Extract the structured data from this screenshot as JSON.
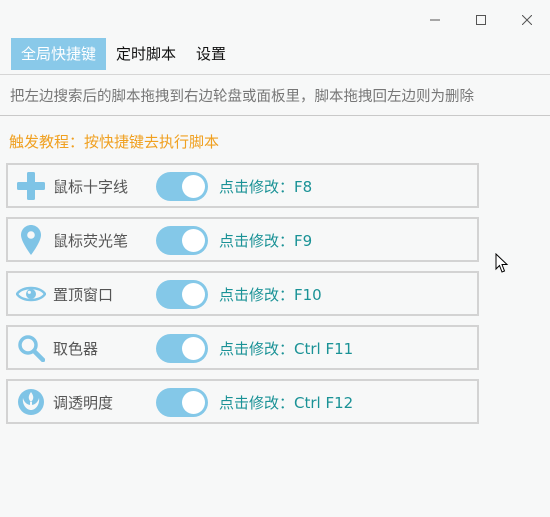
{
  "window": {
    "controls": [
      "minimize",
      "maximize",
      "close"
    ]
  },
  "tabs": [
    {
      "label": "全局快捷键",
      "active": true
    },
    {
      "label": "定时脚本",
      "active": false
    },
    {
      "label": "设置",
      "active": false
    }
  ],
  "hint": "把左边搜索后的脚本拖拽到右边轮盘或面板里，脚本拖拽回左边则为删除",
  "tutorial": "触发教程：按快捷键去执行脚本",
  "shortcuts": [
    {
      "icon": "crosshair-icon",
      "name": "鼠标十字线",
      "enabled": true,
      "shortcut": "点击修改：F8"
    },
    {
      "icon": "map-pin-icon",
      "name": "鼠标荧光笔",
      "enabled": true,
      "shortcut": "点击修改：F9"
    },
    {
      "icon": "eye-icon",
      "name": "置顶窗口",
      "enabled": true,
      "shortcut": "点击修改：F10"
    },
    {
      "icon": "magnifier-icon",
      "name": "取色器",
      "enabled": true,
      "shortcut": "点击修改：Ctrl F11"
    },
    {
      "icon": "rebel-alliance-icon",
      "name": "调透明度",
      "enabled": true,
      "shortcut": "点击修改：Ctrl F12"
    }
  ],
  "colors": {
    "accent": "#89c9e9",
    "toggle_on": "#84c8e8",
    "tutorial_text": "#f0a020",
    "shortcut_text": "#1a9296",
    "icon": "#7fc4e6"
  }
}
